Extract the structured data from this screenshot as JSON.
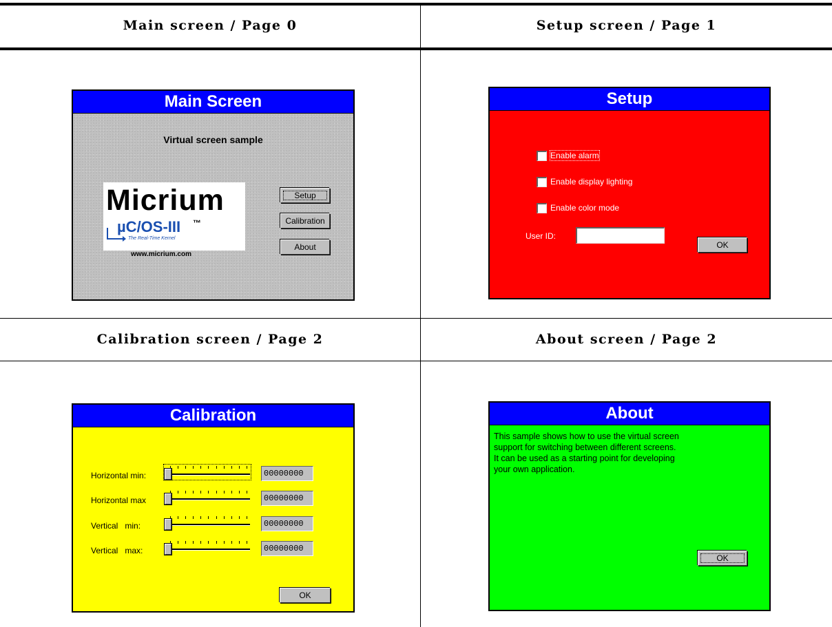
{
  "headers": {
    "top_left": "Main screen / Page 0",
    "top_right": "Setup screen / Page 1",
    "bottom_left": "Calibration screen / Page 2",
    "bottom_right": "About screen / Page 2"
  },
  "main_screen": {
    "title": "Main Screen",
    "subtitle": "Virtual screen sample",
    "logo": {
      "brand": "Micrium",
      "product": "µC/OS-III",
      "trademark": "™",
      "tagline": "The Real-Time Kernel",
      "url": "www.micrium.com"
    },
    "buttons": {
      "setup": "Setup",
      "calibration": "Calibration",
      "about": "About"
    },
    "colors": {
      "title_bar": "#0000ff",
      "background": "#c0c0c0"
    }
  },
  "setup_screen": {
    "title": "Setup",
    "checkboxes": [
      {
        "label": "Enable alarm",
        "checked": false,
        "focused": true
      },
      {
        "label": "Enable display lighting",
        "checked": false
      },
      {
        "label": "Enable color mode",
        "checked": false
      }
    ],
    "user_id_label": "User ID:",
    "user_id_value": "",
    "ok": "OK",
    "colors": {
      "title_bar": "#0000ff",
      "background": "#ff0000"
    }
  },
  "calibration_screen": {
    "title": "Calibration",
    "rows": [
      {
        "label": "Horizontal min:",
        "value": "00000000",
        "slider_position": 0
      },
      {
        "label": "Horizontal max",
        "value": "00000000",
        "slider_position": 0
      },
      {
        "label": "Vertical   min:",
        "value": "00000000",
        "slider_position": 0
      },
      {
        "label": "Vertical   max:",
        "value": "00000000",
        "slider_position": 0
      }
    ],
    "ok": "OK",
    "colors": {
      "title_bar": "#0000ff",
      "background": "#ffff00"
    }
  },
  "about_screen": {
    "title": "About",
    "text_lines": [
      "This sample shows how to use the virtual screen",
      "support for switching between different screens.",
      "It can be used as a starting point for developing",
      "your own application."
    ],
    "ok": "OK",
    "colors": {
      "title_bar": "#0000ff",
      "background": "#00ff00"
    }
  }
}
